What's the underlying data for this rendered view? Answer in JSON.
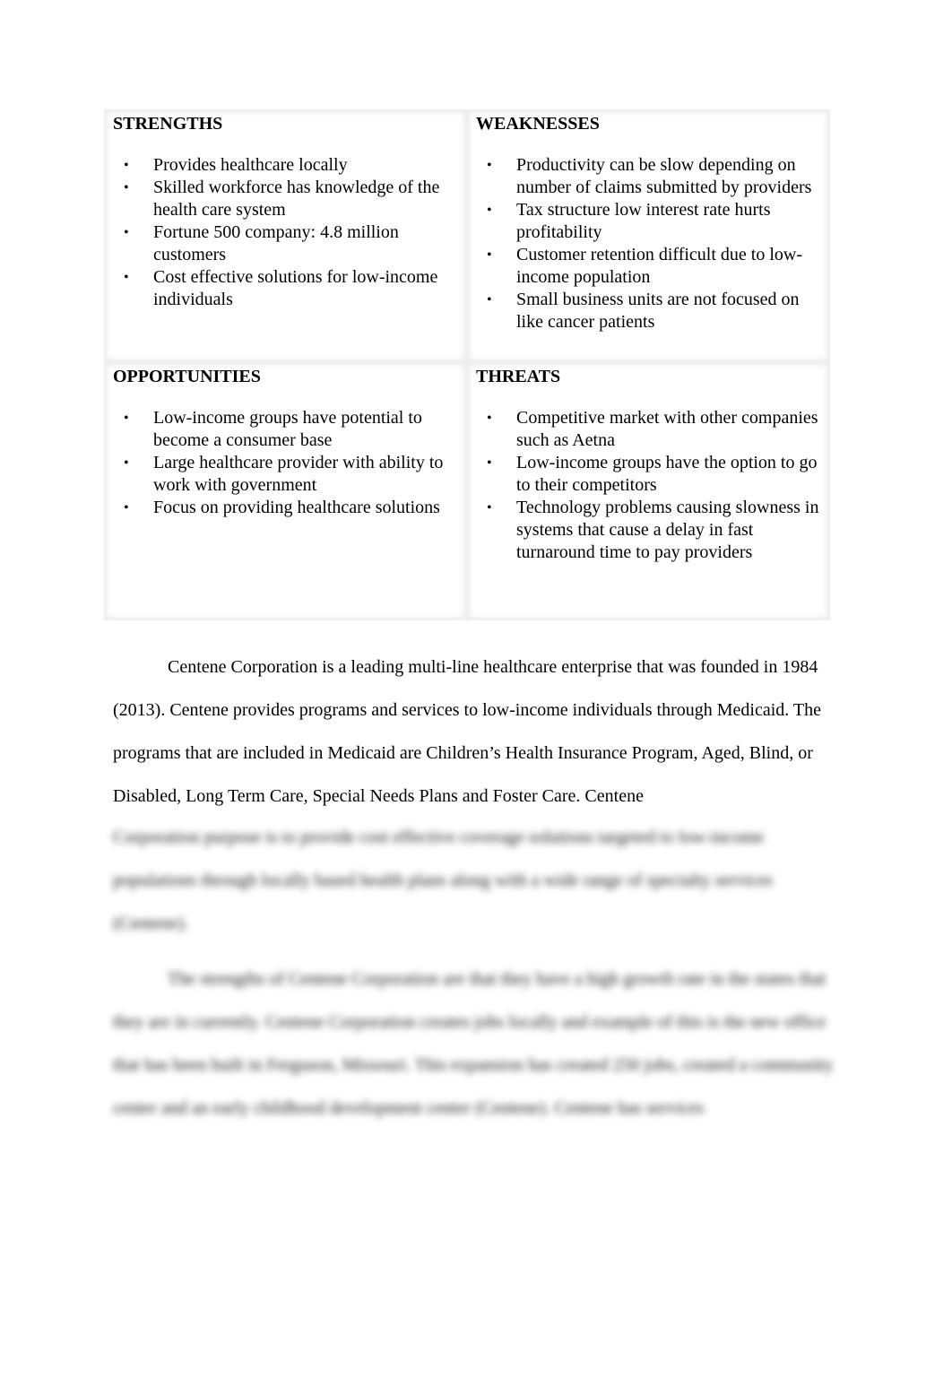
{
  "swot": {
    "strengths": {
      "title": "STRENGTHS",
      "items": [
        "Provides healthcare locally",
        "Skilled workforce has knowledge of the health care system",
        "Fortune 500 company: 4.8 million customers",
        "Cost effective solutions for low-income individuals"
      ]
    },
    "weaknesses": {
      "title": "WEAKNESSES",
      "items": [
        "Productivity can be slow depending on number of claims submitted by providers",
        "Tax structure low interest rate hurts profitability",
        "Customer retention difficult due to low-income population",
        "Small business units are not focused on like cancer patients"
      ]
    },
    "opportunities": {
      "title": "OPPORTUNITIES",
      "items": [
        "Low-income groups have potential to become a consumer base",
        "Large healthcare provider with ability to work with government",
        "Focus on providing healthcare solutions"
      ]
    },
    "threats": {
      "title": "THREATS",
      "items": [
        "Competitive market with other companies such as Aetna",
        "Low-income groups have the option to go to their competitors",
        "Technology problems causing slowness in systems that cause a delay in fast turnaround time to pay providers"
      ]
    }
  },
  "body": {
    "paragraph1": "Centene Corporation is a leading multi-line healthcare enterprise that was founded in 1984 (2013). Centene provides programs and services to low-income individuals through Medicaid. The programs that are included in Medicaid are Children’s Health Insurance Program, Aged, Blind, or Disabled, Long Term Care, Special Needs Plans and Foster Care. Centene",
    "paragraph1_blurred": "Corporation purpose is to provide cost effective coverage solutions targeted to low-income populations through locally based health plans along with a wide range of specialty services (Centene).",
    "paragraph2_blurred": "The strengths of Centene Corporation are that they have a high growth rate in the states that they are in currently. Centene Corporation creates jobs locally and example of this is the new office that has been built in Ferguson, Missouri. This expansion has created 250 jobs, created a community center and an early childhood development center (Centene). Centene has services"
  }
}
